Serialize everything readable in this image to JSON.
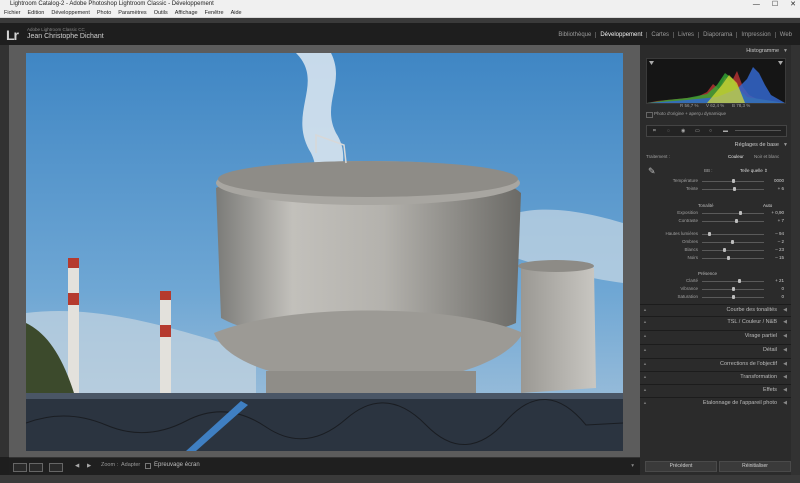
{
  "window": {
    "title": "Lightroom Catalog-2 - Adobe Photoshop Lightroom Classic - Développement",
    "controls": [
      "—",
      "☐",
      "✕"
    ]
  },
  "menu": [
    "Fichier",
    "Edition",
    "Développement",
    "Photo",
    "Paramètres",
    "Outils",
    "Affichage",
    "Fenêtre",
    "Aide"
  ],
  "identity": {
    "logo": "Lr",
    "product": "Adobe Lightroom Classic CC",
    "user": "Jean Christophe Dichant"
  },
  "modules": [
    {
      "label": "Bibliothèque",
      "active": false
    },
    {
      "label": "Développement",
      "active": true
    },
    {
      "label": "Cartes",
      "active": false
    },
    {
      "label": "Livres",
      "active": false
    },
    {
      "label": "Diaporama",
      "active": false
    },
    {
      "label": "Impression",
      "active": false
    },
    {
      "label": "Web",
      "active": false
    }
  ],
  "histogram": {
    "title": "Histogramme",
    "readout": [
      "R  56,7  %",
      "V  62,4  %",
      "B  78,3  %"
    ],
    "original_label": "Photo d'origine + aperçu dynamique"
  },
  "basic": {
    "title": "Réglages de base",
    "treatment_label": "Traitement :",
    "treatment_options": [
      "Couleur",
      "Noir et blanc"
    ],
    "wb_label": "BB :",
    "wb_value": "Tel/e quelle ⇕",
    "sliders_wb": [
      {
        "label": "Température",
        "value": "0000",
        "pos": 0.5
      },
      {
        "label": "Teinte",
        "value": "+ 6",
        "pos": 0.52
      }
    ],
    "tone_label": "Tonalité",
    "auto_label": "Auto",
    "sliders_tone": [
      {
        "label": "Exposition",
        "value": "+ 0,90",
        "pos": 0.62
      },
      {
        "label": "Contraste",
        "value": "+ 7",
        "pos": 0.55
      }
    ],
    "sliders_light": [
      {
        "label": "Hautes lumières",
        "value": "– 94",
        "pos": 0.1
      },
      {
        "label": "Ombres",
        "value": "– 2",
        "pos": 0.48
      },
      {
        "label": "Blancs",
        "value": "– 23",
        "pos": 0.35
      },
      {
        "label": "Noirs",
        "value": "– 15",
        "pos": 0.42
      }
    ],
    "presence_label": "Présence",
    "sliders_presence": [
      {
        "label": "Clarté",
        "value": "+ 21",
        "pos": 0.6
      },
      {
        "label": "Vibrance",
        "value": "0",
        "pos": 0.5
      },
      {
        "label": "Saturation",
        "value": "0",
        "pos": 0.5
      }
    ]
  },
  "sections": [
    {
      "name": "Courbe des tonalités"
    },
    {
      "name": "TSL  /  Couleur  /  N&B"
    },
    {
      "name": "Virage partiel"
    },
    {
      "name": "Détail"
    },
    {
      "name": "Corrections de l'objectif"
    },
    {
      "name": "Transformation"
    },
    {
      "name": "Effets"
    },
    {
      "name": "Etalonnage de l'appareil photo"
    }
  ],
  "bottombar": {
    "zoom_label": "Zoom :",
    "fit_label": "Adapter",
    "softproof_label": "Epreuvage écran"
  },
  "buttons": {
    "previous": "Précédent",
    "reset": "Réinitialiser"
  }
}
